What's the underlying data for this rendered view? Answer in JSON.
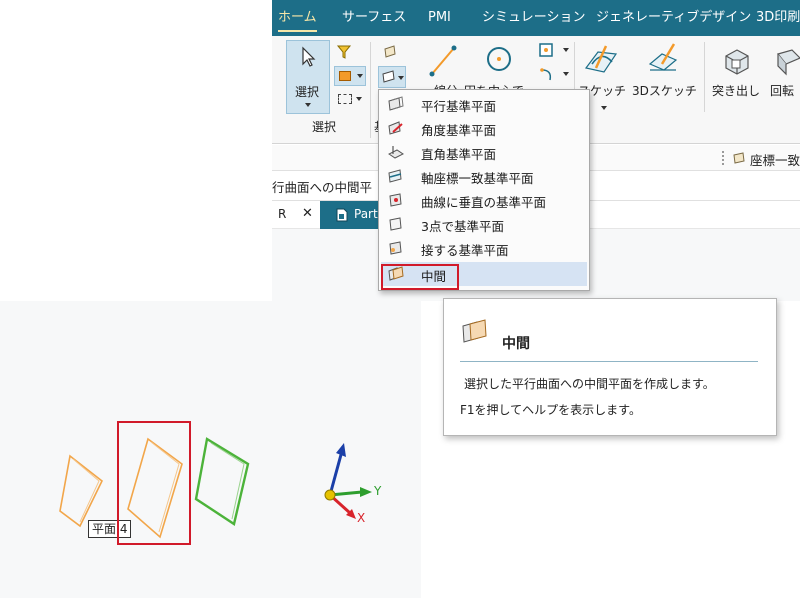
{
  "ribbon_tabs": [
    {
      "label": "ホーム",
      "active": true
    },
    {
      "label": "サーフェス"
    },
    {
      "label": "PMI"
    },
    {
      "label": "シミュレーション"
    },
    {
      "label": "ジェネレーティブデザイン"
    },
    {
      "label": "3D印刷"
    }
  ],
  "ribbon": {
    "select_label": "選択",
    "select_group_label": "選択",
    "plane_group_label_partial": "基",
    "line_label": "線分",
    "circle_label": "円を中心で",
    "sketch_label": "スケッチ",
    "sketch3d_label": "3Dスケッチ",
    "extrude_label": "突き出し",
    "revolve_label": "回転"
  },
  "coord_button_label": "座標一致",
  "command_hint": "行曲面への中間平",
  "doc_tabs": [
    {
      "label": "R"
    },
    {
      "label": "Part"
    }
  ],
  "plane_menu": {
    "items": [
      {
        "label": "平行基準平面"
      },
      {
        "label": "角度基準平面"
      },
      {
        "label": "直角基準平面"
      },
      {
        "label": "軸座標一致基準平面"
      },
      {
        "label": "曲線に垂直の基準平面"
      },
      {
        "label": "3点で基準平面"
      },
      {
        "label": "接する基準平面"
      },
      {
        "label": "中間",
        "highlighted": true
      }
    ]
  },
  "tooltip": {
    "title": "中間",
    "description": "選択した平行曲面への中間平面を作成します。",
    "help": "F1を押してヘルプを表示します。"
  },
  "viewport": {
    "plane_label": "平面 4",
    "axis_y": "Y",
    "axis_x": "X"
  },
  "colors": {
    "tab_bar": "#1d6e88",
    "active_tab_text": "#f6e6a8",
    "highlight_box": "#d11a2a",
    "orange_plane": "#f2a64a",
    "green_plane": "#4cb33a",
    "axis_y": "#2e9e2e",
    "axis_z": "#1b3fa8",
    "axis_x": "#d8242c"
  }
}
